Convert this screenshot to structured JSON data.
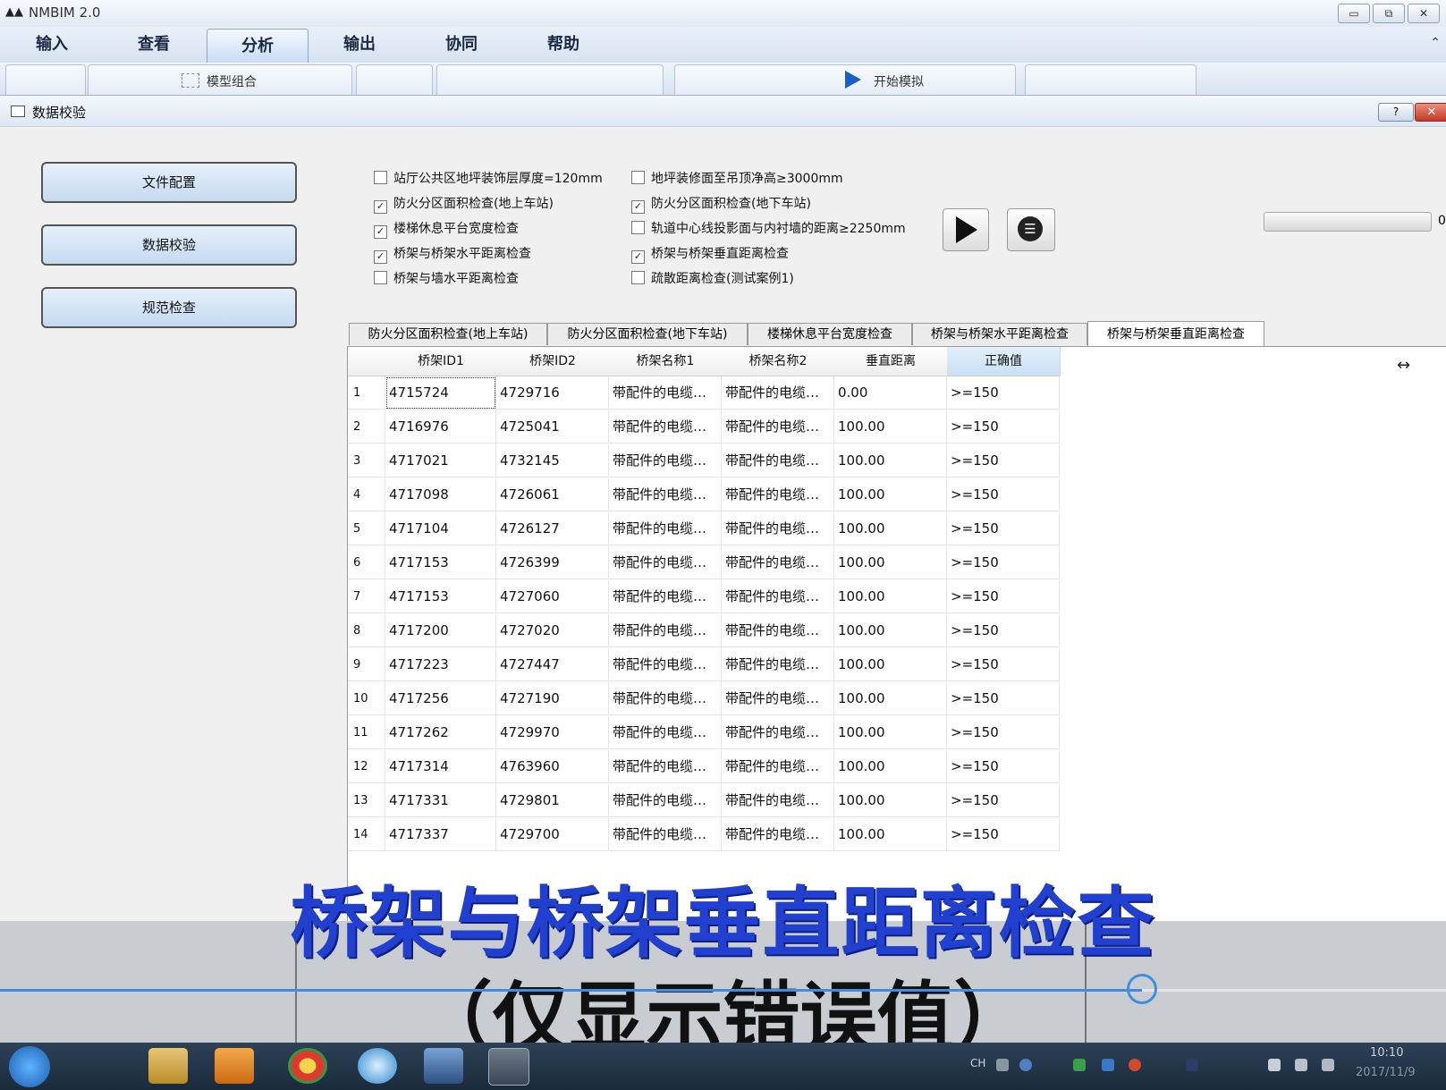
{
  "app": {
    "title": "NMBIM 2.0",
    "window_buttons": [
      "▭",
      "⧉",
      "✕"
    ],
    "ribbon_collapse": "⌃"
  },
  "menu": {
    "items": [
      "输入",
      "查看",
      "分析",
      "输出",
      "协同",
      "帮助"
    ],
    "active": "分析"
  },
  "ribbon": {
    "model_group_label": "模型组合",
    "start_sim_label": "开始模拟"
  },
  "dialog": {
    "title": "数据校验",
    "help_label": "?",
    "close_label": "✕",
    "side_buttons": [
      "文件配置",
      "数据校验",
      "规范检查"
    ],
    "checks_col1": [
      {
        "label": "站厅公共区地坪装饰层厚度=120mm",
        "checked": false
      },
      {
        "label": "防火分区面积检查(地上车站)",
        "checked": true
      },
      {
        "label": "楼梯休息平台宽度检查",
        "checked": true
      },
      {
        "label": "桥架与桥架水平距离检查",
        "checked": true
      },
      {
        "label": "桥架与墙水平距离检查",
        "checked": false
      }
    ],
    "checks_col2": [
      {
        "label": "地坪装修面至吊顶净高≥3000mm",
        "checked": false
      },
      {
        "label": "防火分区面积检查(地下车站)",
        "checked": true
      },
      {
        "label": "轨道中心线投影面与内衬墙的距离≥2250mm",
        "checked": false
      },
      {
        "label": "桥架与桥架垂直距离检查",
        "checked": true
      },
      {
        "label": "疏散距离检查(测试案例1)",
        "checked": false
      }
    ],
    "check_mark": "✓",
    "export_icon_glyph": "☰",
    "progress": {
      "value": 0,
      "text": "0"
    },
    "tabs": [
      "防火分区面积检查(地上车站)",
      "防火分区面积检查(地下车站)",
      "楼梯休息平台宽度检查",
      "桥架与桥架水平距离检查",
      "桥架与桥架垂直距离检查"
    ],
    "active_tab": 4
  },
  "grid": {
    "columns": [
      "桥架ID1",
      "桥架ID2",
      "桥架名称1",
      "桥架名称2",
      "垂直距离",
      "正确值"
    ],
    "rows": [
      [
        "1",
        "4715724",
        "4729716",
        "带配件的电缆…",
        "带配件的电缆…",
        "0.00",
        ">=150"
      ],
      [
        "2",
        "4716976",
        "4725041",
        "带配件的电缆…",
        "带配件的电缆…",
        "100.00",
        ">=150"
      ],
      [
        "3",
        "4717021",
        "4732145",
        "带配件的电缆…",
        "带配件的电缆…",
        "100.00",
        ">=150"
      ],
      [
        "4",
        "4717098",
        "4726061",
        "带配件的电缆…",
        "带配件的电缆…",
        "100.00",
        ">=150"
      ],
      [
        "5",
        "4717104",
        "4726127",
        "带配件的电缆…",
        "带配件的电缆…",
        "100.00",
        ">=150"
      ],
      [
        "6",
        "4717153",
        "4726399",
        "带配件的电缆…",
        "带配件的电缆…",
        "100.00",
        ">=150"
      ],
      [
        "7",
        "4717153",
        "4727060",
        "带配件的电缆…",
        "带配件的电缆…",
        "100.00",
        ">=150"
      ],
      [
        "8",
        "4717200",
        "4727020",
        "带配件的电缆…",
        "带配件的电缆…",
        "100.00",
        ">=150"
      ],
      [
        "9",
        "4717223",
        "4727447",
        "带配件的电缆…",
        "带配件的电缆…",
        "100.00",
        ">=150"
      ],
      [
        "10",
        "4717256",
        "4727190",
        "带配件的电缆…",
        "带配件的电缆…",
        "100.00",
        ">=150"
      ],
      [
        "11",
        "4717262",
        "4729970",
        "带配件的电缆…",
        "带配件的电缆…",
        "100.00",
        ">=150"
      ],
      [
        "12",
        "4717314",
        "4763960",
        "带配件的电缆…",
        "带配件的电缆…",
        "100.00",
        ">=150"
      ],
      [
        "13",
        "4717331",
        "4729801",
        "带配件的电缆…",
        "带配件的电缆…",
        "100.00",
        ">=150"
      ],
      [
        "14",
        "4717337",
        "4729700",
        "带配件的电缆…",
        "带配件的电缆…",
        "100.00",
        ">=150"
      ]
    ],
    "resize_cursor": "↔"
  },
  "caption": {
    "line1": "桥架与桥架垂直距离检查",
    "line2": "（仅显示错误值）"
  },
  "video": {
    "progress_fraction": 0.79
  },
  "taskbar": {
    "tray_lang": "CH",
    "clock_time": "10:10",
    "clock_date": "2017/11/9"
  },
  "colors": {
    "caption_blue": "#2140d0",
    "seek_blue": "#3e8fe0",
    "progress_green": "#37a237"
  }
}
